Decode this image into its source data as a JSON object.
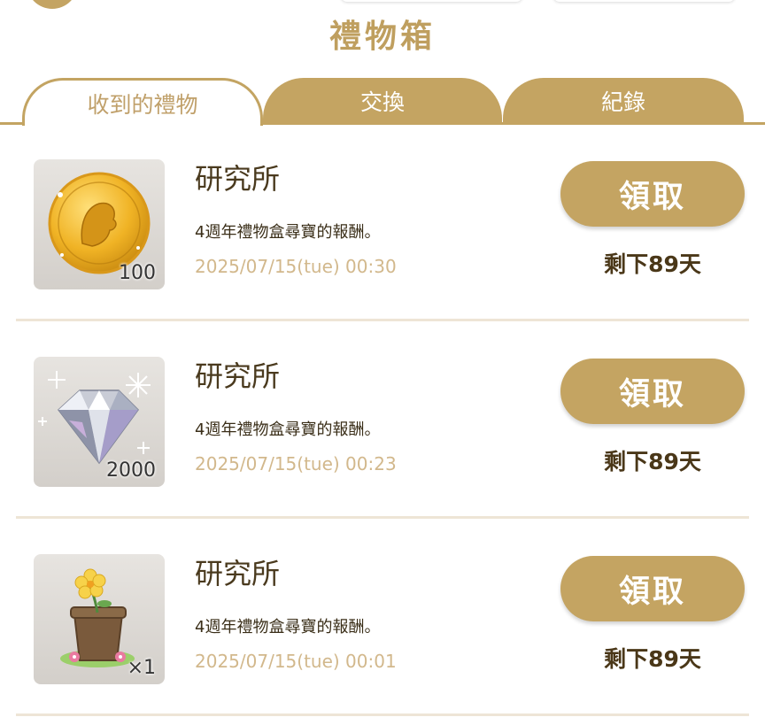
{
  "title": "禮物箱",
  "tabs": [
    {
      "label": "收到的禮物",
      "active": true
    },
    {
      "label": "交換",
      "active": false
    },
    {
      "label": "紀錄",
      "active": false
    }
  ],
  "gifts": [
    {
      "icon": "gold-coin-icon",
      "quantity": "100",
      "sender": "研究所",
      "description": "4週年禮物盒尋寶的報酬。",
      "date": "2025/07/15(tue) 00:30",
      "claim_label": "領取",
      "remaining": "剩下89天"
    },
    {
      "icon": "diamond-icon",
      "quantity": "2000",
      "sender": "研究所",
      "description": "4週年禮物盒尋寶的報酬。",
      "date": "2025/07/15(tue) 00:23",
      "claim_label": "領取",
      "remaining": "剩下89天"
    },
    {
      "icon": "flower-pot-icon",
      "quantity": "×1",
      "sender": "研究所",
      "description": "4週年禮物盒尋寶的報酬。",
      "date": "2025/07/15(tue) 00:01",
      "claim_label": "領取",
      "remaining": "剩下89天"
    }
  ],
  "colors": {
    "accent": "#c4a462",
    "title": "#bf9f5f",
    "date": "#d2b88c",
    "separator": "#eee5d6"
  }
}
